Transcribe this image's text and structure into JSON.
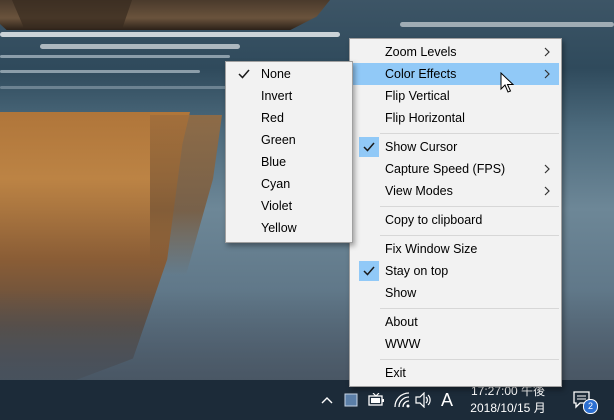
{
  "main_menu": {
    "items": [
      {
        "label": "Zoom Levels",
        "submenu": true,
        "checked": false,
        "highlighted": false
      },
      {
        "label": "Color Effects",
        "submenu": true,
        "checked": false,
        "highlighted": true
      },
      {
        "label": "Flip Vertical",
        "submenu": false,
        "checked": false,
        "highlighted": false
      },
      {
        "label": "Flip Horizontal",
        "submenu": false,
        "checked": false,
        "highlighted": false
      },
      {
        "label": "Show Cursor",
        "submenu": false,
        "checked": true,
        "highlighted": false
      },
      {
        "label": "Capture Speed (FPS)",
        "submenu": true,
        "checked": false,
        "highlighted": false
      },
      {
        "label": "View Modes",
        "submenu": true,
        "checked": false,
        "highlighted": false
      },
      {
        "label": "Copy to clipboard",
        "submenu": false,
        "checked": false,
        "highlighted": false
      },
      {
        "label": "Fix Window Size",
        "submenu": false,
        "checked": false,
        "highlighted": false
      },
      {
        "label": "Stay on top",
        "submenu": false,
        "checked": true,
        "highlighted": false
      },
      {
        "label": "Show",
        "submenu": false,
        "checked": false,
        "highlighted": false
      },
      {
        "label": "About",
        "submenu": false,
        "checked": false,
        "highlighted": false
      },
      {
        "label": "WWW",
        "submenu": false,
        "checked": false,
        "highlighted": false
      },
      {
        "label": "Exit",
        "submenu": false,
        "checked": false,
        "highlighted": false
      }
    ]
  },
  "color_effects_submenu": {
    "items": [
      {
        "label": "None",
        "checked": true
      },
      {
        "label": "Invert",
        "checked": false
      },
      {
        "label": "Red",
        "checked": false
      },
      {
        "label": "Green",
        "checked": false
      },
      {
        "label": "Blue",
        "checked": false
      },
      {
        "label": "Cyan",
        "checked": false
      },
      {
        "label": "Violet",
        "checked": false
      },
      {
        "label": "Yellow",
        "checked": false
      }
    ]
  },
  "taskbar": {
    "ime_label": "A",
    "time": "17:27:00 午後",
    "date": "2018/10/15 月",
    "notification_count": "2"
  },
  "icons": {
    "tray_overflow": "chevron-up-icon",
    "app_tray": "app-tray-icon",
    "battery": "battery-icon",
    "network": "wifi-icon",
    "volume": "speaker-icon",
    "notifications": "action-center-icon"
  },
  "colors": {
    "menu_bg": "#f2f2f2",
    "highlight": "#91c9f7",
    "taskbar": "#1c2b39",
    "badge": "#2c6fd1"
  }
}
